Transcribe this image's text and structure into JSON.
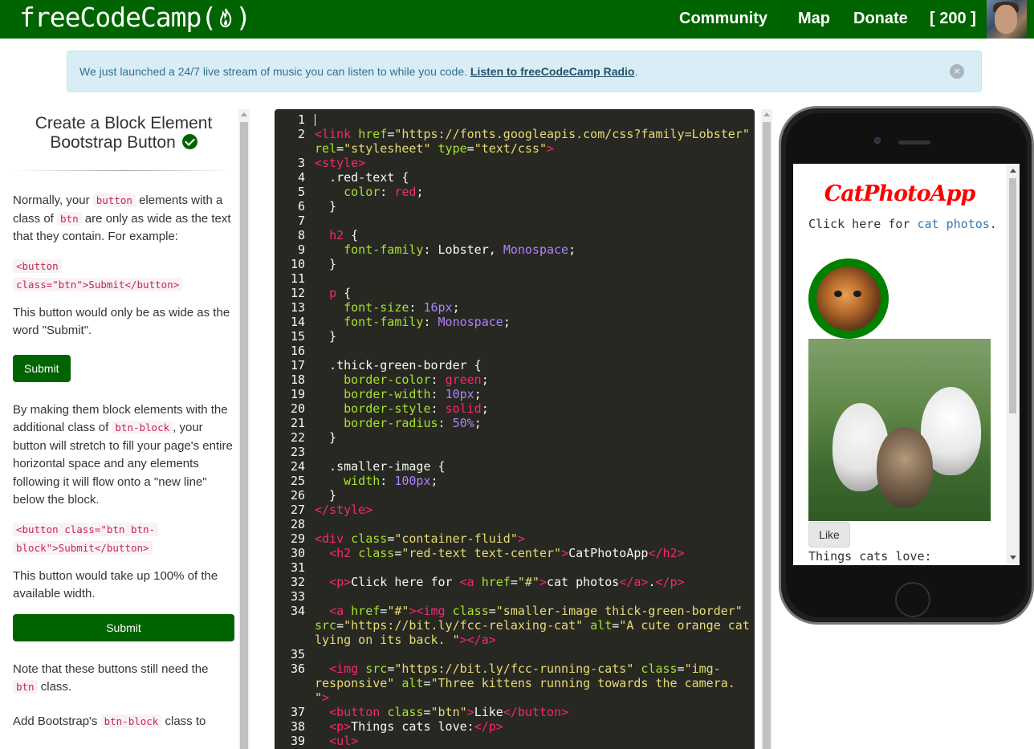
{
  "navbar": {
    "brand": "freeCodeCamp",
    "links": [
      "Community",
      "Map",
      "Donate",
      "[ 200 ]"
    ]
  },
  "alert": {
    "text": "We just launched a 24/7 live stream of music you can listen to while you code. ",
    "link": "Listen to freeCodeCamp Radio",
    "after": ".",
    "close": "×"
  },
  "challenge": {
    "title_line1": "Create a Block Element",
    "title_line2": "Bootstrap Button",
    "p1_a": "Normally, your ",
    "p1_code1": "button",
    "p1_b": " elements with a class of ",
    "p1_code2": "btn",
    "p1_c": " are only as wide as the text that they contain. For example:",
    "code1_line1": "<button",
    "code1_line2": "class=\"btn\">Submit</button>",
    "p2": "This button would only be as wide as the word \"Submit\".",
    "submit_small": "Submit",
    "p3_a": "By making them block elements with the additional class of ",
    "p3_code": "btn-block",
    "p3_b": ", your button will stretch to fill your page's entire horizontal space and any elements following it will flow onto a \"new line\" below the block.",
    "code2_line1": "<button class=\"btn btn-",
    "code2_line2": "block\">Submit</button>",
    "p4": "This button would take up 100% of the available width.",
    "submit_full": "Submit",
    "p5_a": "Note that these buttons still need the ",
    "p5_code": "btn",
    "p5_b": " class.",
    "p6_a": "Add Bootstrap's ",
    "p6_code": "btn-block",
    "p6_b": " class to"
  },
  "editor": {
    "line_numbers": [
      "1",
      "2",
      "",
      "3",
      "4",
      "5",
      "6",
      "7",
      "8",
      "9",
      "10",
      "11",
      "12",
      "13",
      "14",
      "15",
      "16",
      "17",
      "18",
      "19",
      "20",
      "21",
      "22",
      "23",
      "24",
      "25",
      "26",
      "27",
      "28",
      "29",
      "30",
      "31",
      "32",
      "33",
      "34",
      "",
      "",
      "35",
      "36",
      "",
      "",
      "37",
      "38",
      "39"
    ]
  },
  "preview": {
    "title": "CatPhotoApp",
    "p_text": "Click here for ",
    "p_link": "cat photos",
    "p_end": ".",
    "like": "Like",
    "things": "Things cats love:"
  }
}
